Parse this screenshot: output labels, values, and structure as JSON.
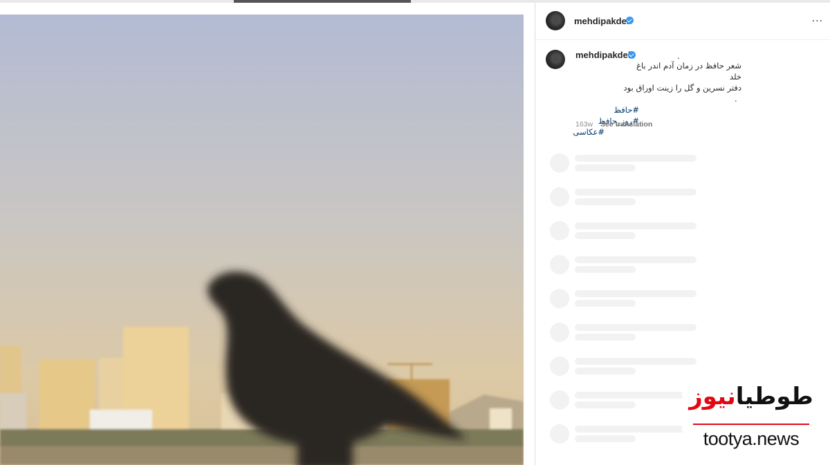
{
  "post": {
    "username": "mehdipakdel",
    "more_icon": "...",
    "caption_dot": ".",
    "caption_lines": [
      "شعر حافظ در زمان آدم اندر باغ خلد",
      "دفتر نسرین و گل را زینت اوراق بود",
      "."
    ],
    "hashtags": [
      "#حافظ #روز_حافظ",
      "#عکاسی"
    ],
    "time_ago": "163w",
    "see_translation": "See translation"
  },
  "watermark": {
    "fa_black": "طوطیا",
    "fa_red": "نیوز",
    "en": "tootya.news"
  },
  "colors": {
    "verified": "#3897f0",
    "hashtag": "#00376b",
    "watermark_red": "#e30613"
  }
}
